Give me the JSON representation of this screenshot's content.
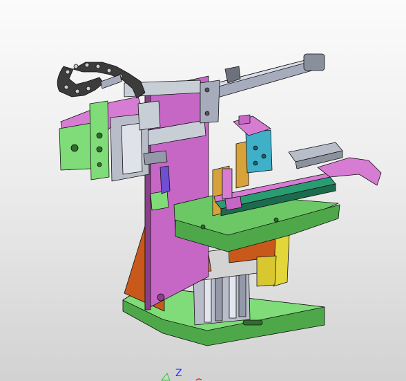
{
  "viewport": {
    "background_top": "#fbfbfb",
    "background_bottom": "#d2d2d2"
  },
  "model": {
    "part_colors": {
      "base_plate": "#7fdc78",
      "vertical_plate": "#c667c6",
      "rear_bracket": "#c8591a",
      "yellow_block": "#d8a23a",
      "slide_cover": "#3fb0c8",
      "cylinder": "#a7acbd",
      "chain_carrier": "#3c3c3c",
      "tray_plate": "#d77cd3"
    }
  },
  "triad": {
    "z_label": "Z",
    "z_color": "#1a39ff",
    "y_color": "#28c828",
    "x_color": "#ff2020"
  }
}
